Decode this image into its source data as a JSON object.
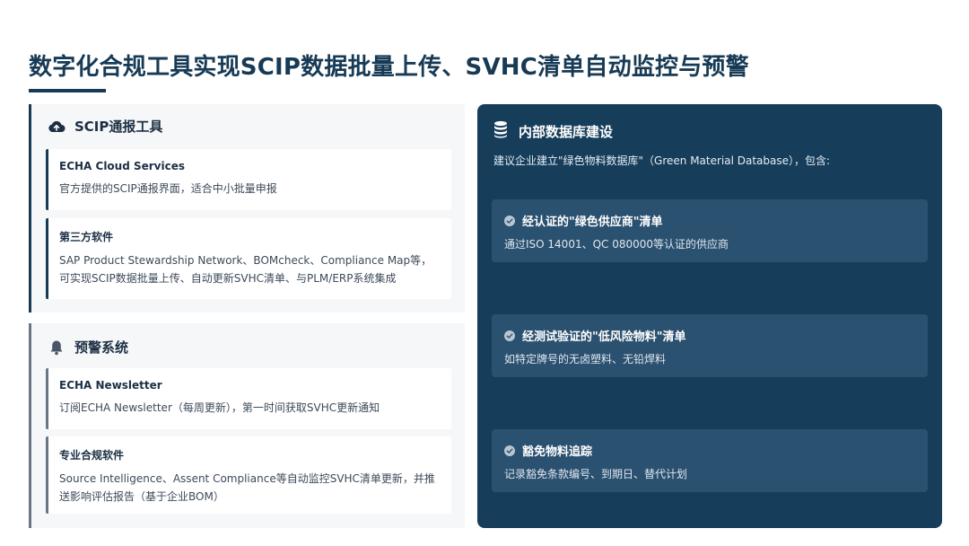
{
  "page": {
    "title": "数字化合规工具实现SCIP数据批量上传、SVHC清单自动监控与预警"
  },
  "left": {
    "scip": {
      "icon": "cloud-upload-icon",
      "heading": "SCIP通报工具",
      "cards": [
        {
          "title": "ECHA Cloud Services",
          "desc": "官方提供的SCIP通报界面，适合中小批量申报"
        },
        {
          "title": "第三方软件",
          "desc": "SAP Product Stewardship Network、BOMcheck、Compliance Map等，可实现SCIP数据批量上传、自动更新SVHC清单、与PLM/ERP系统集成"
        }
      ]
    },
    "alert": {
      "icon": "bell-icon",
      "heading": "预警系统",
      "cards": [
        {
          "title": "ECHA Newsletter",
          "desc": "订阅ECHA Newsletter（每周更新），第一时间获取SVHC更新通知"
        },
        {
          "title": "专业合规软件",
          "desc": "Source Intelligence、Assent Compliance等自动监控SVHC清单更新，并推送影响评估报告（基于企业BOM）"
        }
      ]
    }
  },
  "right": {
    "icon": "database-icon",
    "heading": "内部数据库建设",
    "intro": "建议企业建立\"绿色物料数据库\"（Green Material Database），包含:",
    "items": [
      {
        "title": "经认证的\"绿色供应商\"清单",
        "desc": "通过ISO 14001、QC 080000等认证的供应商"
      },
      {
        "title": "经测试验证的\"低风险物料\"清单",
        "desc": "如特定牌号的无卤塑料、无铅焊料"
      },
      {
        "title": "豁免物料追踪",
        "desc": "记录豁免条款编号、到期日、替代计划"
      }
    ]
  },
  "colors": {
    "primary": "#173a55",
    "panel_dark": "#163e5b",
    "item_bg": "#2b5170",
    "panel_light": "#f6f7f9"
  }
}
